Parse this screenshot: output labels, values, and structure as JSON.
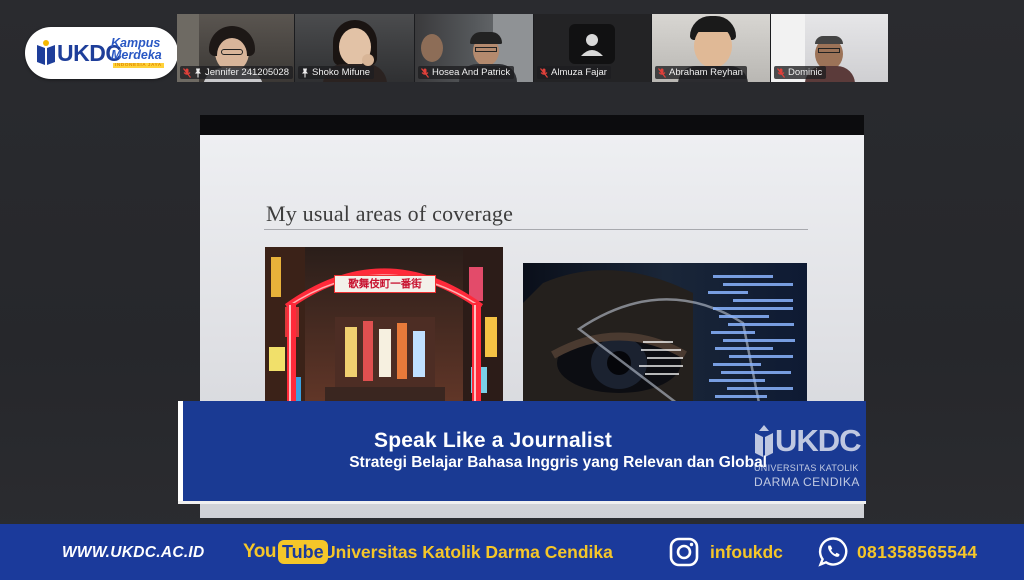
{
  "logo": {
    "ukdc": "UKDC",
    "kampus": "Kampus",
    "merdeka": "Merdeka",
    "tagline": "INDONESIA JAYA"
  },
  "participants": [
    {
      "name": "Jennifer 241205028",
      "muted": true,
      "pinned": true,
      "active": false
    },
    {
      "name": "Shoko Mifune",
      "muted": false,
      "pinned": true,
      "active": true
    },
    {
      "name": "Hosea And Patrick",
      "muted": true,
      "pinned": false,
      "active": false
    },
    {
      "name": "Almuza Fajar",
      "muted": true,
      "pinned": false,
      "active": false
    },
    {
      "name": "Abraham Reyhan",
      "muted": true,
      "pinned": false,
      "active": false
    },
    {
      "name": "Dominic",
      "muted": true,
      "pinned": false,
      "active": false
    }
  ],
  "slide": {
    "title": "My usual areas of coverage",
    "gate_sign": "歌舞伎町一番街"
  },
  "banner": {
    "title": "Speak Like a Journalist",
    "subtitle": "Strategi Belajar Bahasa Inggris yang Relevan dan Global",
    "logo_ukdc": "UKDC",
    "logo_univ": "UNIVERSITAS KATOLIK",
    "logo_darma": "DARMA CENDIKA"
  },
  "footer": {
    "website": "WWW.UKDC.AC.ID",
    "youtube_you": "You",
    "youtube_tube": "Tube",
    "youtube_channel": "Universitas Katolik Darma Cendika",
    "instagram": "infoukdc",
    "whatsapp": "081358565544"
  },
  "colors": {
    "brand_blue": "#1b3a9b",
    "accent_yellow": "#f5c629",
    "active_speaker": "#3ec16a",
    "muted_red": "#e0403a"
  }
}
